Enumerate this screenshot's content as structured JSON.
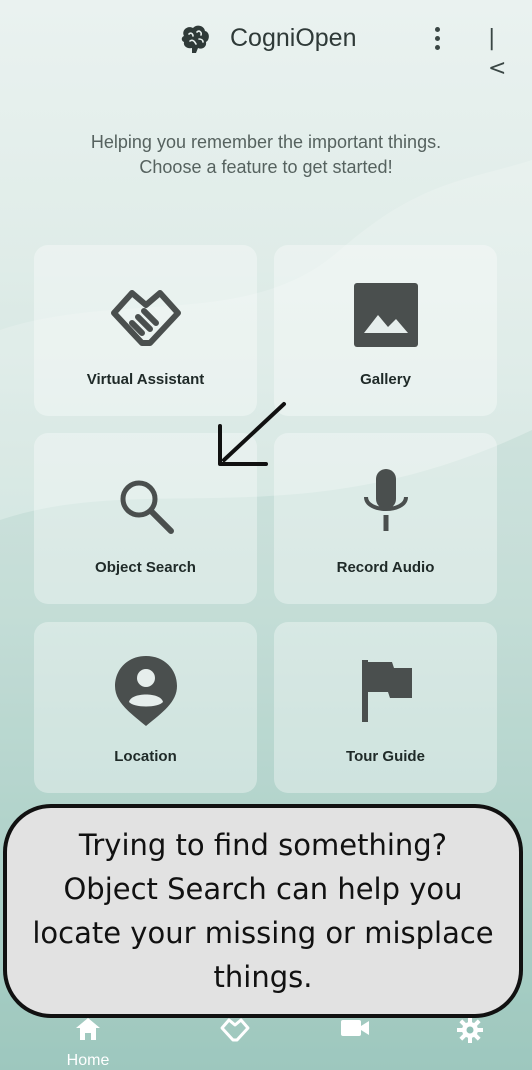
{
  "app": {
    "title": "CogniOpen"
  },
  "intro": {
    "line1": "Helping you remember the important things.",
    "line2": "Choose a feature to get started!"
  },
  "features": [
    {
      "label": "Virtual Assistant",
      "icon": "handshake-icon"
    },
    {
      "label": "Gallery",
      "icon": "image-icon"
    },
    {
      "label": "Object Search",
      "icon": "search-icon"
    },
    {
      "label": "Record Audio",
      "icon": "microphone-icon"
    },
    {
      "label": "Location",
      "icon": "person-pin-icon"
    },
    {
      "label": "Tour Guide",
      "icon": "flag-icon"
    }
  ],
  "callout": {
    "text": "Trying to find something? Object Search can help you locate your missing or misplace things."
  },
  "nav": [
    {
      "label": "Home",
      "icon": "home-icon"
    },
    {
      "label": "",
      "icon": "handshake-icon"
    },
    {
      "label": "",
      "icon": "video-icon"
    },
    {
      "label": "",
      "icon": "gear-icon"
    }
  ],
  "colors": {
    "accent_text": "#2f3a38",
    "callout_bg": "#e2e2e2",
    "callout_border": "#111111"
  }
}
